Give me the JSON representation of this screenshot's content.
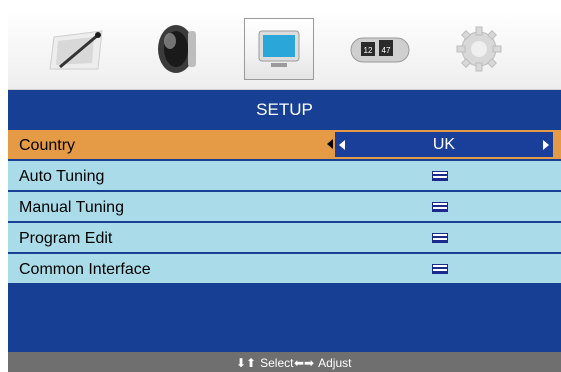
{
  "menu": {
    "title": "SETUP",
    "icons": [
      {
        "name": "picture-icon"
      },
      {
        "name": "sound-icon"
      },
      {
        "name": "setup-tv-icon",
        "selected": true
      },
      {
        "name": "timer-icon",
        "labels": [
          "12",
          "47"
        ]
      },
      {
        "name": "gear-icon"
      }
    ],
    "items": [
      {
        "label": "Country",
        "value": "UK"
      },
      {
        "label": "Auto Tuning"
      },
      {
        "label": "Manual Tuning"
      },
      {
        "label": "Program Edit"
      },
      {
        "label": "Common Interface"
      }
    ]
  },
  "footer": {
    "select_label": "Select",
    "adjust_label": "Adjust"
  },
  "colors": {
    "panel": "#173f93",
    "row": "#a9dce8",
    "active_row": "#e59a45",
    "footer": "#6f6f6f"
  }
}
